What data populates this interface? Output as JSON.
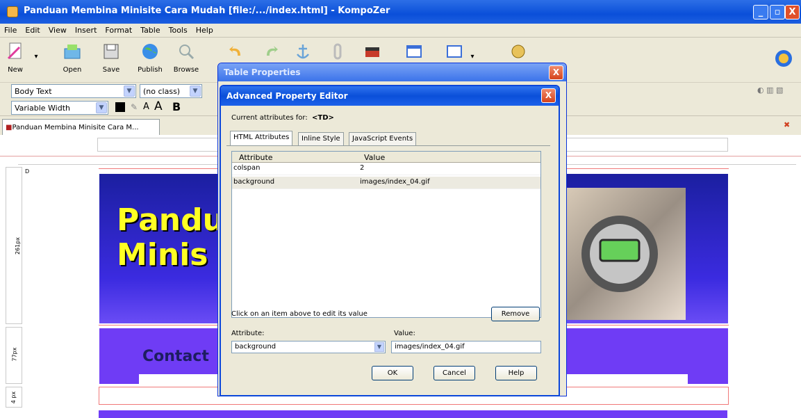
{
  "window": {
    "title": "Panduan Membina Minisite Cara Mudah [file:/.../index.html] - KompoZer",
    "minimize_label": "_",
    "maximize_label": "▫",
    "close_label": "X"
  },
  "menu": [
    "File",
    "Edit",
    "View",
    "Insert",
    "Format",
    "Table",
    "Tools",
    "Help"
  ],
  "toolbar": {
    "new_label": "New",
    "open_label": "Open",
    "save_label": "Save",
    "publish_label": "Publish",
    "browse_label": "Browse"
  },
  "format": {
    "paragraph_style": "Body Text",
    "class_select": "(no class)",
    "font_select": "Variable Width",
    "bold_label": "B",
    "smaller_label": "A",
    "larger_label": "A"
  },
  "document_tab": "Panduan Membina Minisite Cara M...",
  "page": {
    "banner_line1": "Pandu",
    "banner_line2": "Minis",
    "contact_text": "Contact",
    "ruler_left_1": "261px",
    "ruler_left_2": "77px",
    "ruler_left_3": "4 px",
    "ruler_marker": "D"
  },
  "table_properties_dialog": {
    "title": "Table Properties",
    "close_label": "X"
  },
  "advanced_editor": {
    "title": "Advanced Property Editor",
    "close_label": "X",
    "current_attributes_label": "Current attributes for:",
    "current_element": "<TD>",
    "tabs": [
      "HTML Attributes",
      "Inline Style",
      "JavaScript Events"
    ],
    "columns": [
      "Attribute",
      "Value"
    ],
    "rows": [
      {
        "attribute": "colspan",
        "value": "2"
      },
      {
        "attribute": "background",
        "value": "images/index_04.gif"
      }
    ],
    "hint": "Click on an item above to edit its value",
    "remove_label": "Remove",
    "attribute_label": "Attribute:",
    "value_label": "Value:",
    "attribute_value": "background",
    "value_value": "images/index_04.gif",
    "ok_label": "OK",
    "cancel_label": "Cancel",
    "help_label": "Help"
  }
}
